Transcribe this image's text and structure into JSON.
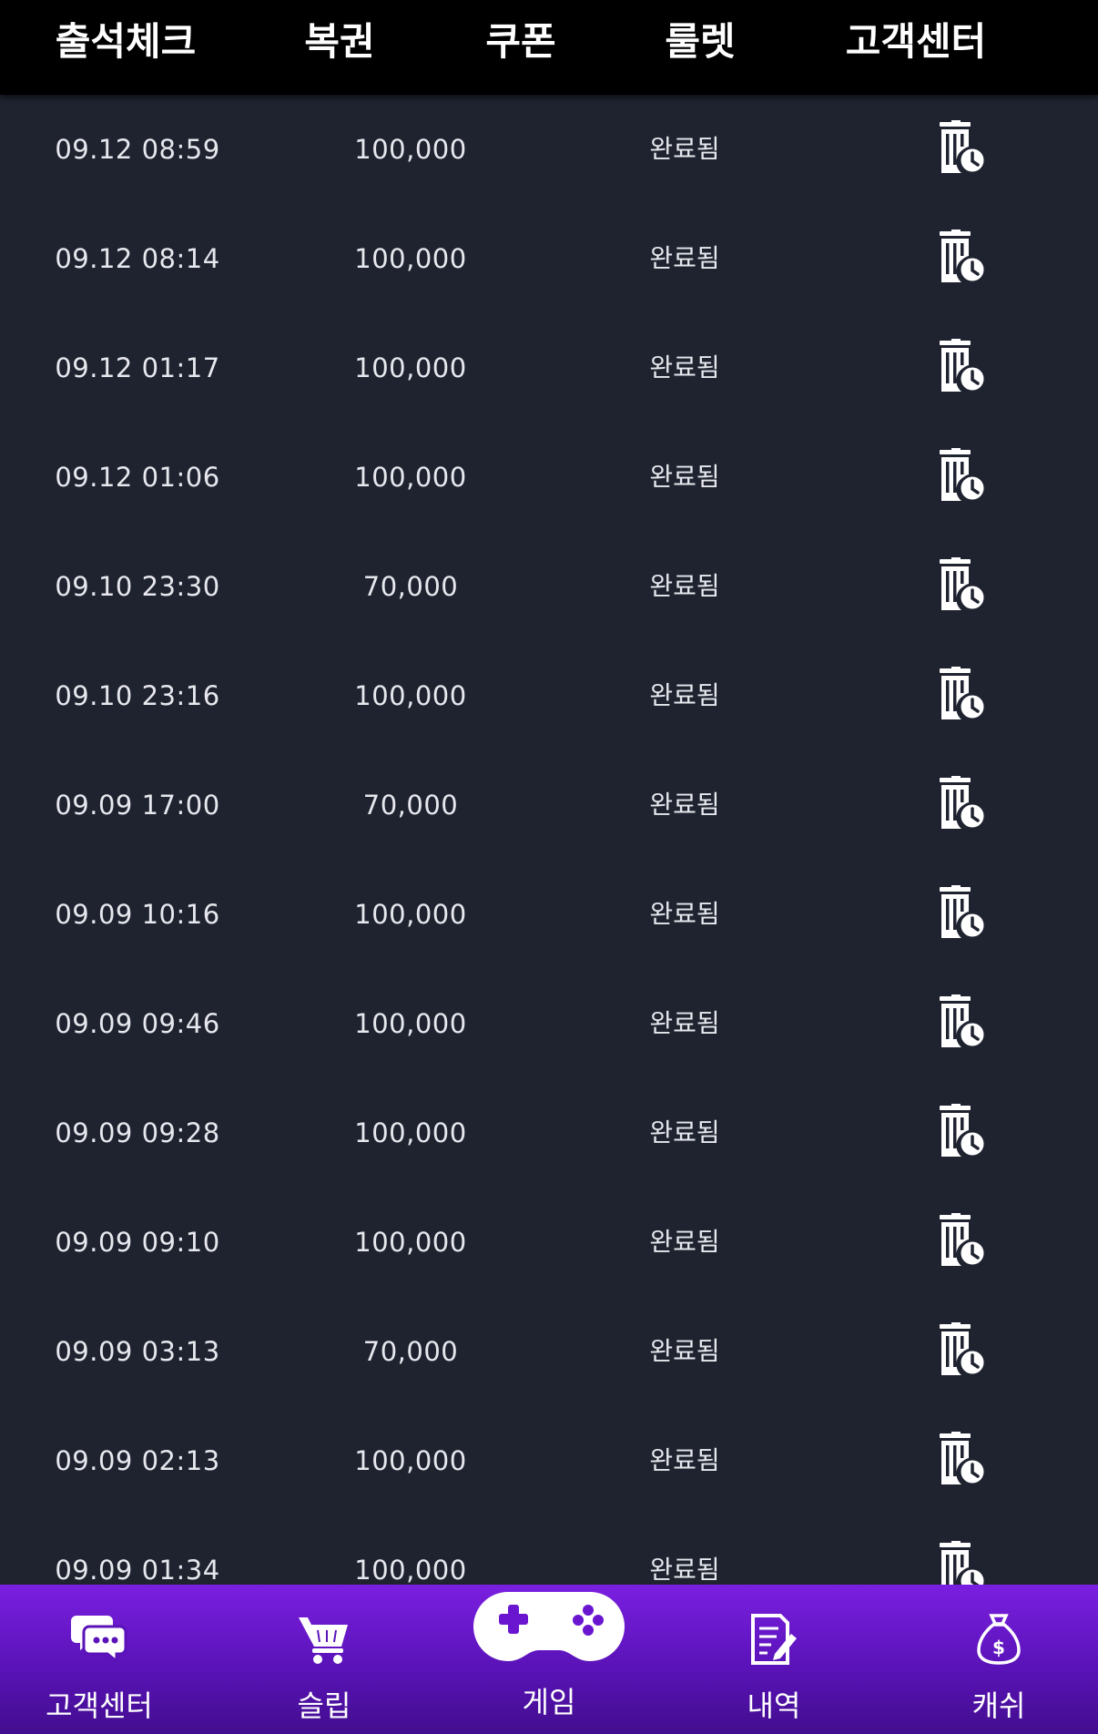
{
  "top_nav": {
    "tabs": [
      {
        "label": "출석체크"
      },
      {
        "label": "복권"
      },
      {
        "label": "쿠폰"
      },
      {
        "label": "룰렛"
      },
      {
        "label": "고객센터"
      }
    ]
  },
  "history": {
    "rows": [
      {
        "date": "09.12 08:59",
        "amount": "100,000",
        "status": "완료됨"
      },
      {
        "date": "09.12 08:14",
        "amount": "100,000",
        "status": "완료됨"
      },
      {
        "date": "09.12 01:17",
        "amount": "100,000",
        "status": "완료됨"
      },
      {
        "date": "09.12 01:06",
        "amount": "100,000",
        "status": "완료됨"
      },
      {
        "date": "09.10 23:30",
        "amount": "70,000",
        "status": "완료됨"
      },
      {
        "date": "09.10 23:16",
        "amount": "100,000",
        "status": "완료됨"
      },
      {
        "date": "09.09 17:00",
        "amount": "70,000",
        "status": "완료됨"
      },
      {
        "date": "09.09 10:16",
        "amount": "100,000",
        "status": "완료됨"
      },
      {
        "date": "09.09 09:46",
        "amount": "100,000",
        "status": "완료됨"
      },
      {
        "date": "09.09 09:28",
        "amount": "100,000",
        "status": "완료됨"
      },
      {
        "date": "09.09 09:10",
        "amount": "100,000",
        "status": "완료됨"
      },
      {
        "date": "09.09 03:13",
        "amount": "70,000",
        "status": "완료됨"
      },
      {
        "date": "09.09 02:13",
        "amount": "100,000",
        "status": "완료됨"
      },
      {
        "date": "09.09 01:34",
        "amount": "100,000",
        "status": "완료됨"
      }
    ],
    "row_icon": "delete-history-icon"
  },
  "bottom_nav": {
    "items": [
      {
        "label": "고객센터",
        "icon": "chat-bubbles-icon"
      },
      {
        "label": "슬립",
        "icon": "cart-icon"
      },
      {
        "label": "게임",
        "icon": "gamepad-icon"
      },
      {
        "label": "내역",
        "icon": "document-edit-icon"
      },
      {
        "label": "캐쉬",
        "icon": "money-bag-icon"
      }
    ]
  },
  "colors": {
    "background": "#1f2330",
    "top_bar": "#000000",
    "bottom_bar_gradient_top": "#7a1fe0",
    "bottom_bar_gradient_bottom": "#420d8e"
  }
}
